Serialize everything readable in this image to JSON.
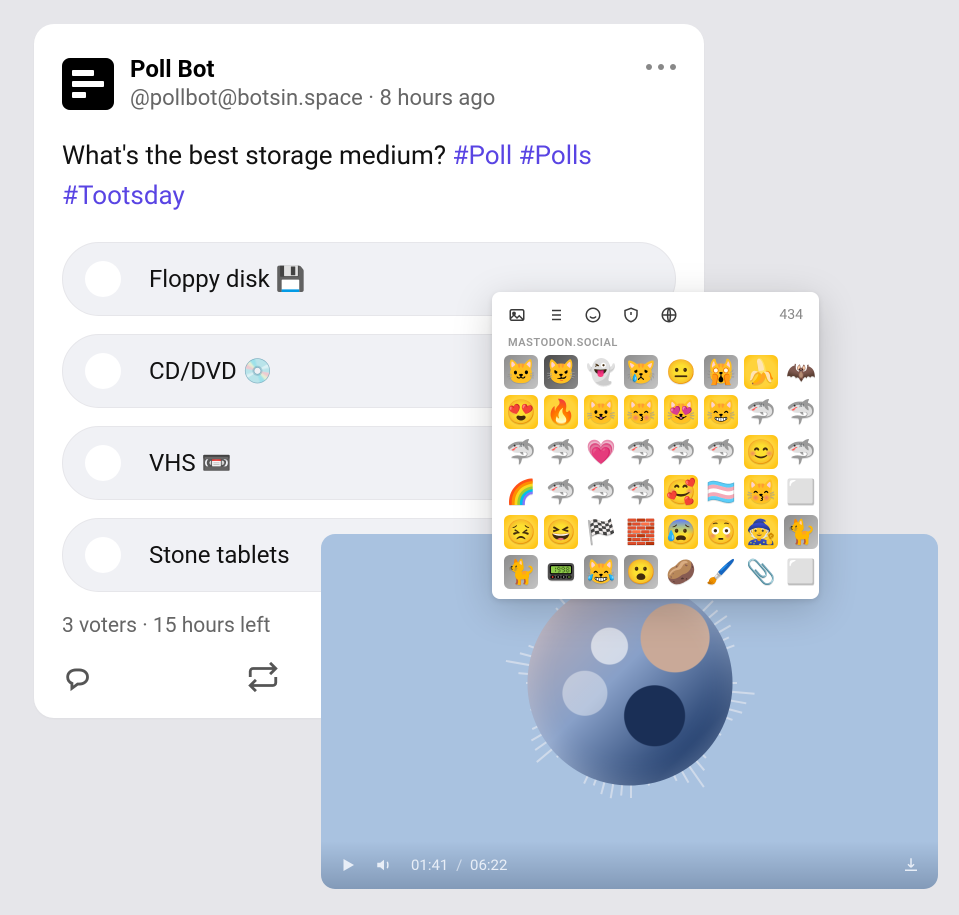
{
  "poll": {
    "name": "Poll Bot",
    "handle": "@pollbot@botsin.space",
    "timestamp": "8 hours ago",
    "question": "What's the best storage medium? ",
    "tags": [
      "#Poll",
      "#Polls",
      "#Tootsday"
    ],
    "options": [
      {
        "label": "Floppy disk 💾"
      },
      {
        "label": "CD/DVD 💿"
      },
      {
        "label": "VHS 📼"
      },
      {
        "label": "Stone tablets"
      }
    ],
    "voters": "3 voters",
    "time_left": "15 hours left"
  },
  "emoji": {
    "server": "MASTODON.SOCIAL",
    "char_count": "434",
    "grid": [
      [
        "🐱",
        "😼",
        "👻",
        "😿",
        "😐",
        "🙀",
        "🍌",
        "🦇"
      ],
      [
        "😍",
        "🔥",
        "😺",
        "😽",
        "😻",
        "😸",
        "🦈",
        "🦈"
      ],
      [
        "🦈",
        "🦈",
        "💗",
        "🦈",
        "🦈",
        "🦈",
        "😊",
        "🦈"
      ],
      [
        "🌈",
        "🦈",
        "🦈",
        "🦈",
        "🥰",
        "🏳️‍⚧️",
        "😽",
        "⬜"
      ],
      [
        "😣",
        "😆",
        "🏁",
        "🧱",
        "😰",
        "😳",
        "🧙",
        "🐈"
      ],
      [
        "🐈",
        "📟",
        "😹",
        "😮",
        "🥔",
        "🖌️",
        "📎",
        "⬜"
      ]
    ]
  },
  "audio": {
    "current_time": "01:41",
    "total_time": "06:22"
  }
}
